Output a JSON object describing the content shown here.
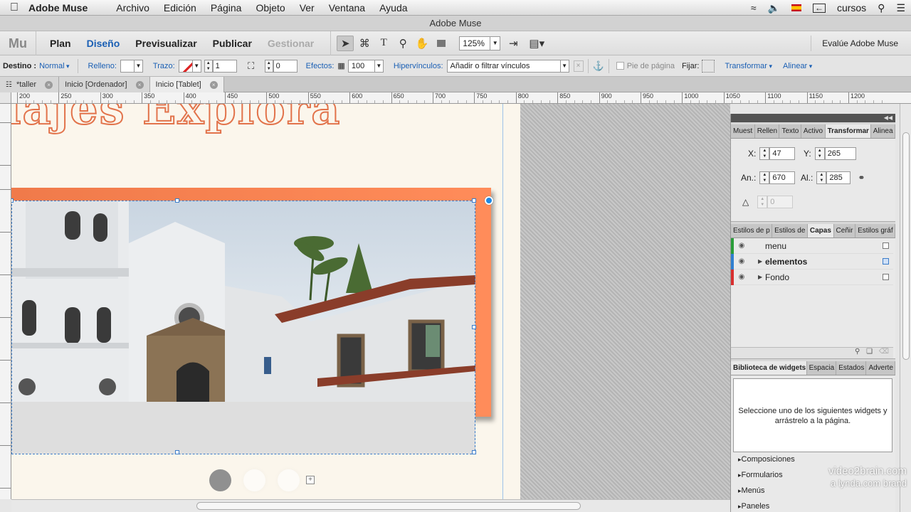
{
  "menubar": {
    "app_name": "Adobe Muse",
    "menus": [
      "Archivo",
      "Edición",
      "Página",
      "Objeto",
      "Ver",
      "Ventana",
      "Ayuda"
    ],
    "user": "cursos"
  },
  "window": {
    "title": "Adobe Muse"
  },
  "navbar": {
    "logo": "Mu",
    "plan": "Plan",
    "design": "Diseño",
    "preview": "Previsualizar",
    "publish": "Publicar",
    "manage": "Gestionar",
    "zoom": "125%",
    "evaluate": "Evalúe Adobe Muse"
  },
  "controlbar": {
    "destino_label": "Destino :",
    "destino_value": "Normal",
    "relleno": "Relleno:",
    "trazo": "Trazo:",
    "trazo_value": "1",
    "corner_value": "0",
    "efectos": "Efectos:",
    "efectos_value": "100",
    "hipervinculos": "Hipervínculos:",
    "hyperlink_placeholder": "Añadir o filtrar vínculos",
    "pie_de_pagina": "Pie de página",
    "fijar": "Fijar:",
    "transformar": "Transformar",
    "alinear": "Alinear"
  },
  "tabs": [
    {
      "label": "*taller",
      "active": false
    },
    {
      "label": "Inicio [Ordenador]",
      "active": false
    },
    {
      "label": "Inicio [Tablet]",
      "active": true
    }
  ],
  "ruler": {
    "h_labels": [
      "200",
      "250",
      "300",
      "350",
      "400",
      "450",
      "500",
      "550",
      "600",
      "650",
      "700",
      "750",
      "800",
      "850",
      "900",
      "950",
      "1000",
      "1050",
      "1100",
      "1150",
      "1200"
    ]
  },
  "page": {
    "headline": "iajes Explora"
  },
  "transform_panel": {
    "tabs": [
      "Muest",
      "Rellen",
      "Texto",
      "Activo",
      "Transformar",
      "Alinea"
    ],
    "active_tab": "Transformar",
    "x_label": "X:",
    "x_value": "47",
    "y_label": "Y:",
    "y_value": "265",
    "w_label": "An.:",
    "w_value": "670",
    "h_label": "Al.:",
    "h_value": "285",
    "angle_value": "0"
  },
  "layers_panel": {
    "tabs": [
      "Estilos de p",
      "Estilos de",
      "Capas",
      "Ceñir",
      "Estilos gráf"
    ],
    "active_tab": "Capas",
    "layers": [
      {
        "name": "menu",
        "color": "#2a9d3a",
        "expandable": false,
        "bold": false
      },
      {
        "name": "elementos",
        "color": "#2f7fd0",
        "expandable": true,
        "bold": true
      },
      {
        "name": "Fondo",
        "color": "#d83030",
        "expandable": true,
        "bold": false
      }
    ]
  },
  "widgets_panel": {
    "tabs": [
      "Biblioteca de widgets",
      "Espacia",
      "Estados",
      "Adverte"
    ],
    "active_tab": "Biblioteca de widgets",
    "message": "Seleccione uno de los siguientes widgets y arrástrelo a la página.",
    "categories": [
      "Composiciones",
      "Formularios",
      "Menús",
      "Paneles"
    ]
  },
  "watermark": {
    "line1": "video2brain.com",
    "line2": "a lynda.com brand"
  }
}
